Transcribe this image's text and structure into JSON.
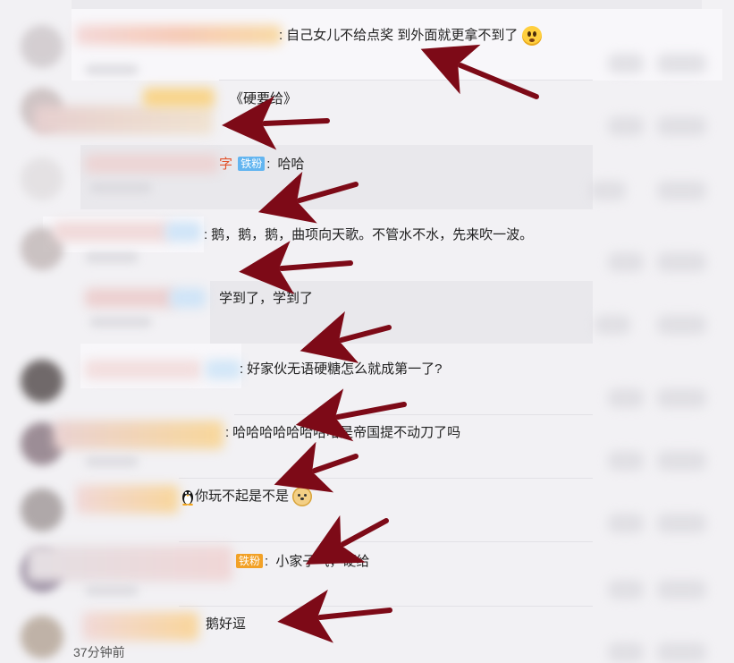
{
  "comments": [
    {
      "text": "自己女儿不给点奖 到外面就更拿不到了",
      "emoji": "scared-face-emoji"
    },
    {
      "text": "《硬要给》"
    },
    {
      "name_visible": "字",
      "badge": "铁粉",
      "text": "哈哈"
    },
    {
      "text": "鹅，鹅，鹅，曲项向天歌。不管水不水，先来吹一波。"
    },
    {
      "text": "学到了，学到了"
    },
    {
      "text": "好家伙无语硬糖怎么就成第一了?"
    },
    {
      "text": "哈哈哈哈哈哈哈哈是帝国提不动刀了吗"
    },
    {
      "text": "你玩不起是不是",
      "emoji_prefix": "penguin-emoji",
      "emoji": "doge-emoji"
    },
    {
      "badge": "铁粉",
      "text": "小家子气，硬给"
    },
    {
      "text": "鹅好逗"
    }
  ],
  "footer_time": "37分钟前",
  "colors": {
    "arrow": "#7d0a17",
    "badge_blue": "#63b5f0",
    "badge_orange": "#f2a126",
    "name_red": "#e2542d"
  }
}
